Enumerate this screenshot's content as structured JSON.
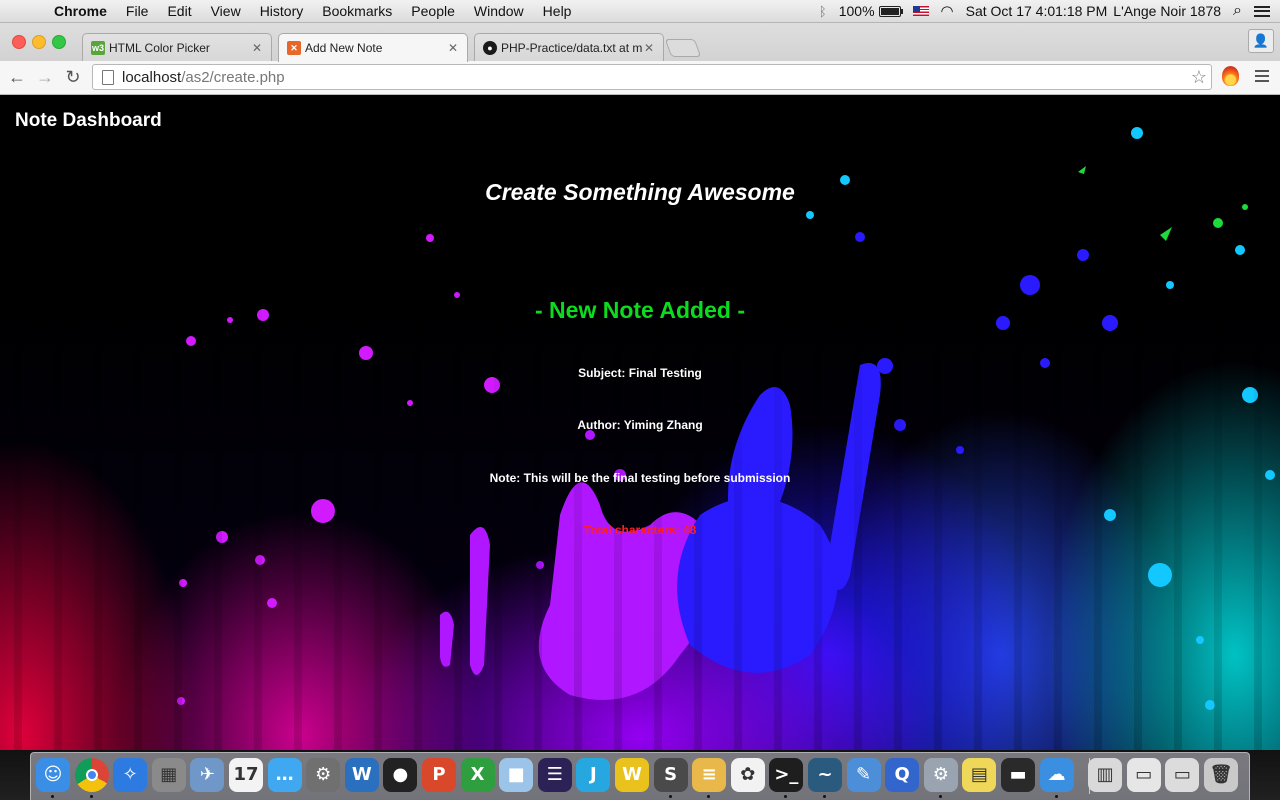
{
  "menubar": {
    "app_name": "Chrome",
    "menus": [
      "File",
      "Edit",
      "View",
      "History",
      "Bookmarks",
      "People",
      "Window",
      "Help"
    ],
    "battery": "100%",
    "battery_level": 1.0,
    "datetime": "Sat Oct 17  4:01:18 PM",
    "user": "L'Ange Noir 1878"
  },
  "browser": {
    "tabs": [
      {
        "label": "HTML Color Picker",
        "favicon": "w3schools-icon",
        "favicon_text": "w3",
        "favicon_color": "#5aa53b",
        "active": false
      },
      {
        "label": "Add New Note",
        "favicon": "xampp-icon",
        "favicon_text": "",
        "favicon_color": "#e8662a",
        "active": true
      },
      {
        "label": "PHP-Practice/data.txt at m",
        "favicon": "github-icon",
        "favicon_text": "",
        "favicon_color": "#1a1a1a",
        "active": false
      }
    ],
    "url_host": "localhost",
    "url_path": "/as2/create.php"
  },
  "page": {
    "nav_title": "Note Dashboard",
    "heading": "Create Something Awesome",
    "status": "- New Note Added -",
    "subject": "Subject: Final Testing",
    "author": "Author: Yiming Zhang",
    "note": "Note: This will be the final testing before submission",
    "char_count": "Total characters: 48",
    "colors": {
      "status": "#0bdc1e",
      "char_count": "#ff1f1f",
      "text": "#ffffff"
    }
  },
  "dock": {
    "apps": [
      {
        "icon": "finder-icon",
        "glyph": "☺",
        "color": "#3a8ee6",
        "running": true
      },
      {
        "icon": "chrome-icon",
        "glyph": "",
        "color": "#e3e3e3",
        "running": true
      },
      {
        "icon": "safari-icon",
        "glyph": "✧",
        "color": "#2d7be0",
        "running": false
      },
      {
        "icon": "calculator-icon",
        "glyph": "▦",
        "color": "#8a8a8a",
        "running": false
      },
      {
        "icon": "preview-icon",
        "glyph": "✈",
        "color": "#6f98c8",
        "running": false
      },
      {
        "icon": "calendar-icon",
        "glyph": "17",
        "color": "#f3f3f3",
        "running": false
      },
      {
        "icon": "messages-icon",
        "glyph": "…",
        "color": "#3fa8f0",
        "running": false
      },
      {
        "icon": "system-preferences-icon",
        "glyph": "⚙",
        "color": "#707070",
        "running": false
      },
      {
        "icon": "word-icon",
        "glyph": "W",
        "color": "#2b6fbf",
        "running": false
      },
      {
        "icon": "qq-icon",
        "glyph": "●",
        "color": "#222222",
        "running": false
      },
      {
        "icon": "powerpoint-icon",
        "glyph": "P",
        "color": "#d9482b",
        "running": false
      },
      {
        "icon": "excel-icon",
        "glyph": "X",
        "color": "#2e9e3f",
        "running": false
      },
      {
        "icon": "virtualbox-icon",
        "glyph": "■",
        "color": "#9cc4e8",
        "running": false
      },
      {
        "icon": "eclipse-icon",
        "glyph": "☰",
        "color": "#2c2255",
        "running": false
      },
      {
        "icon": "intellij-icon",
        "glyph": "J",
        "color": "#27a7e0",
        "running": false
      },
      {
        "icon": "wamp-icon",
        "glyph": "W",
        "color": "#e9c21e",
        "running": false
      },
      {
        "icon": "sublime-text-icon",
        "glyph": "S",
        "color": "#4a4a4a",
        "running": true
      },
      {
        "icon": "notes-icon",
        "glyph": "≡",
        "color": "#e8b84a",
        "running": true
      },
      {
        "icon": "photos-icon",
        "glyph": "✿",
        "color": "#f2f2f2",
        "running": false
      },
      {
        "icon": "terminal-icon",
        "glyph": ">_",
        "color": "#1e1e1e",
        "running": true
      },
      {
        "icon": "mysql-workbench-icon",
        "glyph": "~",
        "color": "#2a5b7e",
        "running": true
      },
      {
        "icon": "xcode-icon",
        "glyph": "✎",
        "color": "#4d8ed9",
        "running": false
      },
      {
        "icon": "quicktime-icon",
        "glyph": "Q",
        "color": "#3366cc",
        "running": false
      },
      {
        "icon": "system-settings-icon",
        "glyph": "⚙",
        "color": "#9aa4b0",
        "running": true
      },
      {
        "icon": "stickies-icon",
        "glyph": "▤",
        "color": "#efd75a",
        "running": false
      },
      {
        "icon": "printer-icon",
        "glyph": "▬",
        "color": "#2a2a2a",
        "running": false
      },
      {
        "icon": "icloud-icon",
        "glyph": "☁",
        "color": "#3a8fe0",
        "running": true
      },
      {
        "icon": "archive-icon",
        "glyph": "▥",
        "color": "#d9d9d9",
        "running": false
      },
      {
        "icon": "downloads-stack-icon",
        "glyph": "▭",
        "color": "#e6e6e6",
        "running": false
      },
      {
        "icon": "documents-stack-icon",
        "glyph": "▭",
        "color": "#dcdcdc",
        "running": false
      },
      {
        "icon": "trash-icon",
        "glyph": "🗑",
        "color": "#c9c9c9",
        "running": false
      }
    ]
  }
}
